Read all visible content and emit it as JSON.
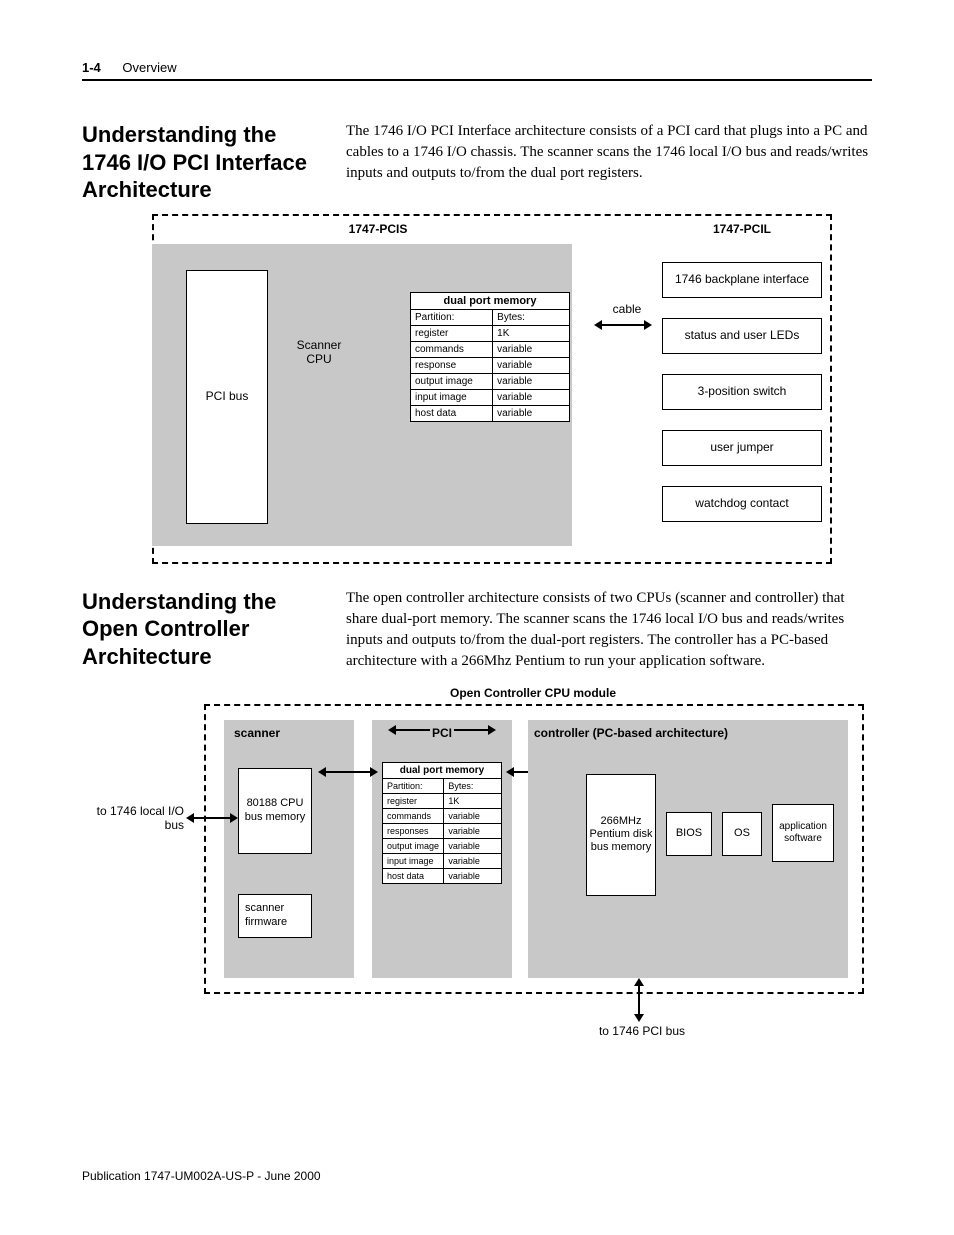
{
  "header": {
    "page_num": "1-4",
    "chapter": "Overview"
  },
  "section1": {
    "title": "Understanding the 1746 I/O PCI Interface Architecture",
    "body": "The 1746 I/O PCI Interface architecture consists of a PCI card that plugs into a PC and cables to a 1746 I/O chassis. The scanner scans the 1746 local I/O bus and reads/writes inputs and outputs to/from the dual port registers."
  },
  "diagram1": {
    "pcis_label": "1747-PCIS",
    "pcil_label": "1747-PCIL",
    "pci_bus": "PCI bus",
    "scanner_cpu": "Scanner CPU",
    "cable": "cable",
    "dpm_title": "dual port memory",
    "dpm_rows": [
      {
        "p": "Partition:",
        "b": "Bytes:"
      },
      {
        "p": "register",
        "b": "1K"
      },
      {
        "p": "commands",
        "b": "variable"
      },
      {
        "p": "response",
        "b": "variable"
      },
      {
        "p": "output image",
        "b": "variable"
      },
      {
        "p": "input image",
        "b": "variable"
      },
      {
        "p": "host data",
        "b": "variable"
      }
    ],
    "pcil_boxes": [
      "1746 backplane interface",
      "status and user LEDs",
      "3-position switch",
      "user jumper",
      "watchdog contact"
    ]
  },
  "section2": {
    "title": "Understanding the Open Controller Architecture",
    "body": "The open controller architecture consists of two CPUs (scanner and controller) that share dual-port memory. The scanner scans the 1746 local I/O bus and reads/writes inputs and outputs to/from the dual-port registers. The controller has a PC-based architecture with a 266Mhz Pentium to run your application software."
  },
  "diagram2": {
    "module_label": "Open Controller CPU module",
    "scanner_label": "scanner",
    "pci_label": "PCI",
    "controller_label": "controller (PC-based architecture)",
    "cpu_box": "80188 CPU bus memory",
    "fw_box": "scanner firmware",
    "dpm_title": "dual port memory",
    "dpm_rows": [
      {
        "p": "Partition:",
        "b": "Bytes:"
      },
      {
        "p": "register",
        "b": "1K"
      },
      {
        "p": "commands",
        "b": "variable"
      },
      {
        "p": "responses",
        "b": "variable"
      },
      {
        "p": "output image",
        "b": "variable"
      },
      {
        "p": "input image",
        "b": "variable"
      },
      {
        "p": "host data",
        "b": "variable"
      }
    ],
    "pentium_box": "266MHz Pentium disk bus memory",
    "bios_box": "BIOS",
    "os_box": "OS",
    "app_box": "application software",
    "io_bus_label": "to 1746 local I/O bus",
    "pci_bus_label": "to 1746 PCI bus"
  },
  "footer": "Publication 1747-UM002A-US-P - June 2000"
}
